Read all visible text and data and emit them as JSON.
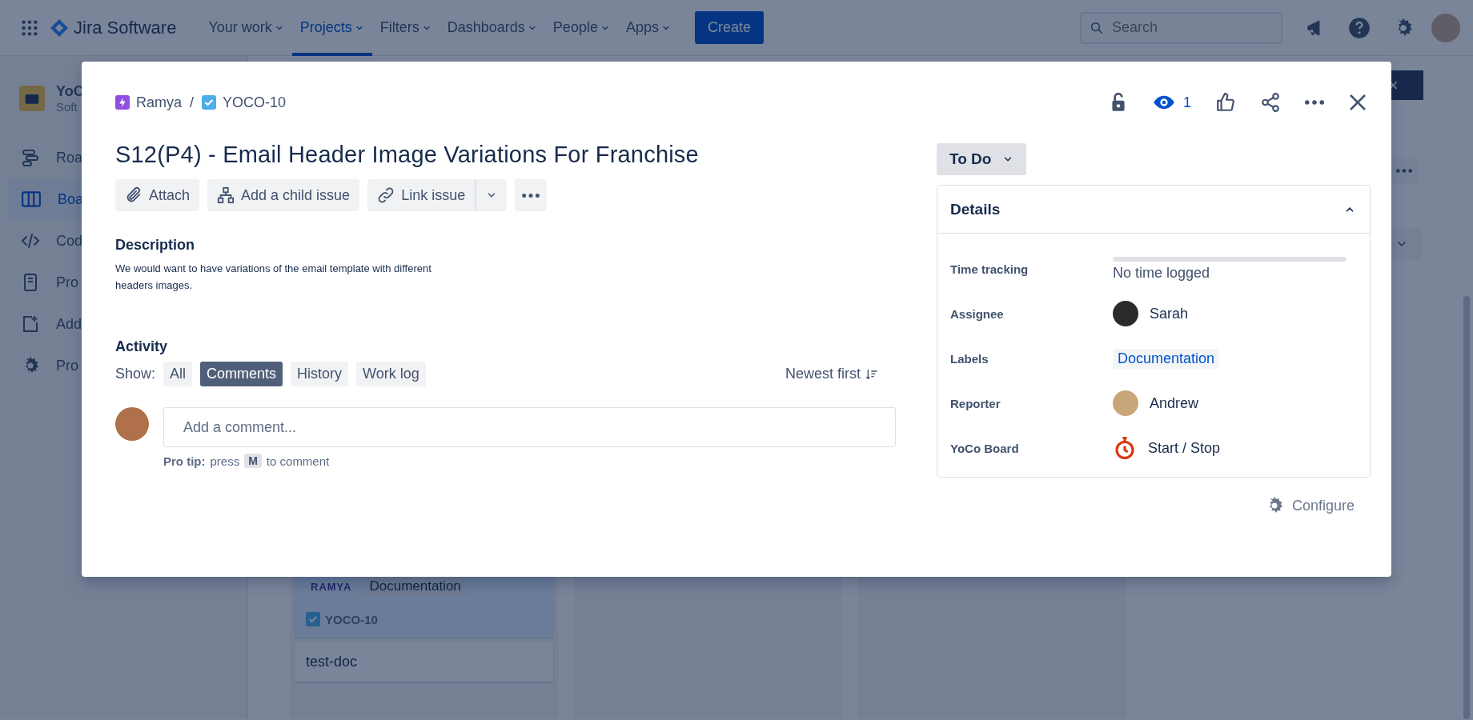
{
  "nav": {
    "product": "Jira Software",
    "menus": [
      {
        "label": "Your work",
        "selected": false
      },
      {
        "label": "Projects",
        "selected": true
      },
      {
        "label": "Filters",
        "selected": false
      },
      {
        "label": "Dashboards",
        "selected": false
      },
      {
        "label": "People",
        "selected": false
      },
      {
        "label": "Apps",
        "selected": false
      }
    ],
    "create": "Create",
    "search": {
      "placeholder": "Search"
    }
  },
  "sidebar": {
    "project_name": "YoC",
    "project_type": "Soft",
    "items": [
      {
        "kind": "roadmap",
        "label": "Roa",
        "selected": false
      },
      {
        "kind": "board",
        "label": "Boa",
        "selected": true
      },
      {
        "kind": "code",
        "label": "Cod",
        "selected": false
      },
      {
        "kind": "pages",
        "label": "Pro",
        "selected": false
      },
      {
        "kind": "add",
        "label": "Add",
        "selected": false
      },
      {
        "kind": "settings",
        "label": "Pro",
        "selected": false
      }
    ]
  },
  "board": {
    "flag_close": "×",
    "card": {
      "epic": "RAMYA",
      "label": "Documentation",
      "key": "YOCO-10",
      "selected": true
    },
    "next_card": {
      "title": "test-doc"
    }
  },
  "issue": {
    "breadcrumbs": [
      {
        "kind": "epic",
        "label": "Ramya"
      },
      {
        "kind": "task",
        "label": "YOCO-10"
      }
    ],
    "separator": "/",
    "watchers": "1",
    "title": "S12(P4) - Email Header Image Variations For Franchise",
    "actions": [
      {
        "kind": "attach",
        "label": "Attach"
      },
      {
        "kind": "child",
        "label": "Add a child issue"
      },
      {
        "kind": "link",
        "label": "Link issue"
      }
    ],
    "description": {
      "heading": "Description",
      "text": "We would want to have variations of the email template with different headers images."
    },
    "activity": {
      "heading": "Activity",
      "show_label": "Show:",
      "filters": [
        {
          "label": "All",
          "selected": false
        },
        {
          "label": "Comments",
          "selected": true
        },
        {
          "label": "History",
          "selected": false
        },
        {
          "label": "Work log",
          "selected": false
        }
      ],
      "sort": "Newest first",
      "comment": {
        "placeholder": "Add a comment..."
      },
      "pro_tip": {
        "label": "Pro tip:",
        "before": "press",
        "key": "M",
        "after": "to comment"
      }
    },
    "status": "To Do",
    "details": {
      "heading": "Details",
      "expanded": true,
      "rows": [
        {
          "kind": "time",
          "label": "Time tracking",
          "value": "No time logged",
          "level": 0
        },
        {
          "kind": "user",
          "label": "Assignee",
          "value": "Sarah",
          "color": "#2b2b2b"
        },
        {
          "kind": "label",
          "label": "Labels",
          "value": "Documentation"
        },
        {
          "kind": "user",
          "label": "Reporter",
          "value": "Andrew",
          "color": "#c9a57a"
        },
        {
          "kind": "timer",
          "label": "YoCo Board",
          "value": "Start / Stop"
        }
      ]
    },
    "configure": "Configure"
  }
}
